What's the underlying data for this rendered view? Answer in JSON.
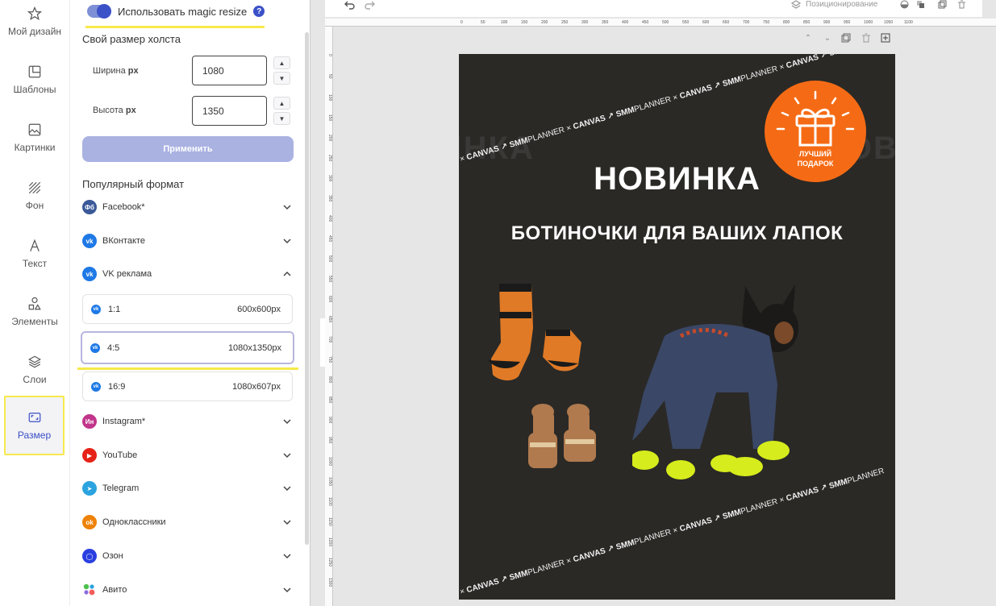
{
  "rail": [
    {
      "id": "my-design",
      "label": "Мой дизайн",
      "icon": "star-icon"
    },
    {
      "id": "templates",
      "label": "Шаблоны",
      "icon": "template-icon"
    },
    {
      "id": "pictures",
      "label": "Картинки",
      "icon": "image-icon"
    },
    {
      "id": "background",
      "label": "Фон",
      "icon": "pattern-icon"
    },
    {
      "id": "text",
      "label": "Текст",
      "icon": "text-icon"
    },
    {
      "id": "elements",
      "label": "Элементы",
      "icon": "shapes-icon"
    },
    {
      "id": "layers",
      "label": "Слои",
      "icon": "layers-icon"
    },
    {
      "id": "size",
      "label": "Размер",
      "icon": "resize-icon",
      "active": true
    }
  ],
  "panel": {
    "magic_resize_label": "Использовать magic resize",
    "magic_resize_on": true,
    "help_glyph": "?",
    "custom_size_title": "Свой размер холста",
    "width_label": "Ширина",
    "height_label": "Высота",
    "unit": "px",
    "width_value": "1080",
    "height_value": "1350",
    "apply_label": "Применить",
    "popular_title": "Популярный формат",
    "networks": [
      {
        "label": "Facebook*",
        "badge": "Фб",
        "color": "#3b5998",
        "expanded": false
      },
      {
        "label": "ВКонтакте",
        "badge": "vk",
        "color": "#1e79e6",
        "expanded": false
      },
      {
        "label": "VK реклама",
        "badge": "vk",
        "color": "#1e79e6",
        "expanded": true
      },
      {
        "label": "Instagram*",
        "badge": "Ин",
        "color": "#c1358a",
        "expanded": false
      },
      {
        "label": "YouTube",
        "badge": "▶",
        "color": "#e62117",
        "expanded": false
      },
      {
        "label": "Telegram",
        "badge": "➤",
        "color": "#2aa3df",
        "expanded": false
      },
      {
        "label": "Одноклассники",
        "badge": "ok",
        "color": "#ee8208",
        "expanded": false
      },
      {
        "label": "Озон",
        "badge": "◯",
        "color": "#2a3fe0",
        "expanded": false
      },
      {
        "label": "Авито",
        "badge": "",
        "color": "#8a6ce0",
        "expanded": false
      }
    ],
    "vk_formats": [
      {
        "ratio": "1:1",
        "size": "600x600px",
        "selected": false
      },
      {
        "ratio": "4:5",
        "size": "1080x1350px",
        "selected": true
      },
      {
        "ratio": "16:9",
        "size": "1080x607px",
        "selected": false
      }
    ]
  },
  "toolbar": {
    "positioning_label": "Позиционирование"
  },
  "ruler_h": [
    "0",
    "50",
    "100",
    "150",
    "200",
    "250",
    "300",
    "350",
    "400",
    "450",
    "500",
    "550",
    "600",
    "650",
    "700",
    "750",
    "800",
    "850",
    "900",
    "950",
    "1000",
    "1050",
    "1100"
  ],
  "ruler_v": [
    "0",
    "50",
    "100",
    "150",
    "200",
    "250",
    "300",
    "350",
    "400",
    "450",
    "500",
    "550",
    "600",
    "650",
    "700",
    "750",
    "800",
    "850",
    "900",
    "950",
    "1000",
    "1050",
    "1100",
    "1150",
    "1200",
    "1250",
    "1300"
  ],
  "canvas": {
    "bg_word": "НОВИНКА",
    "title": "НОВИНКА",
    "subtitle": "БОТИНОЧКИ ДЛЯ ВАШИХ ЛАПОК",
    "badge_text_1": "ЛУЧШИЙ",
    "badge_text_2": "ПОДАРОК",
    "strip_canvas": "CANVAS",
    "strip_smm": "SMM",
    "strip_planner": "PLANNER",
    "strip_sep": "×",
    "colors": {
      "bg": "#2a2926",
      "badge": "#f56b15",
      "boot_orange": "#e07a26",
      "boot_yellow": "#d6ec1c",
      "denim": "#3a4766"
    }
  }
}
